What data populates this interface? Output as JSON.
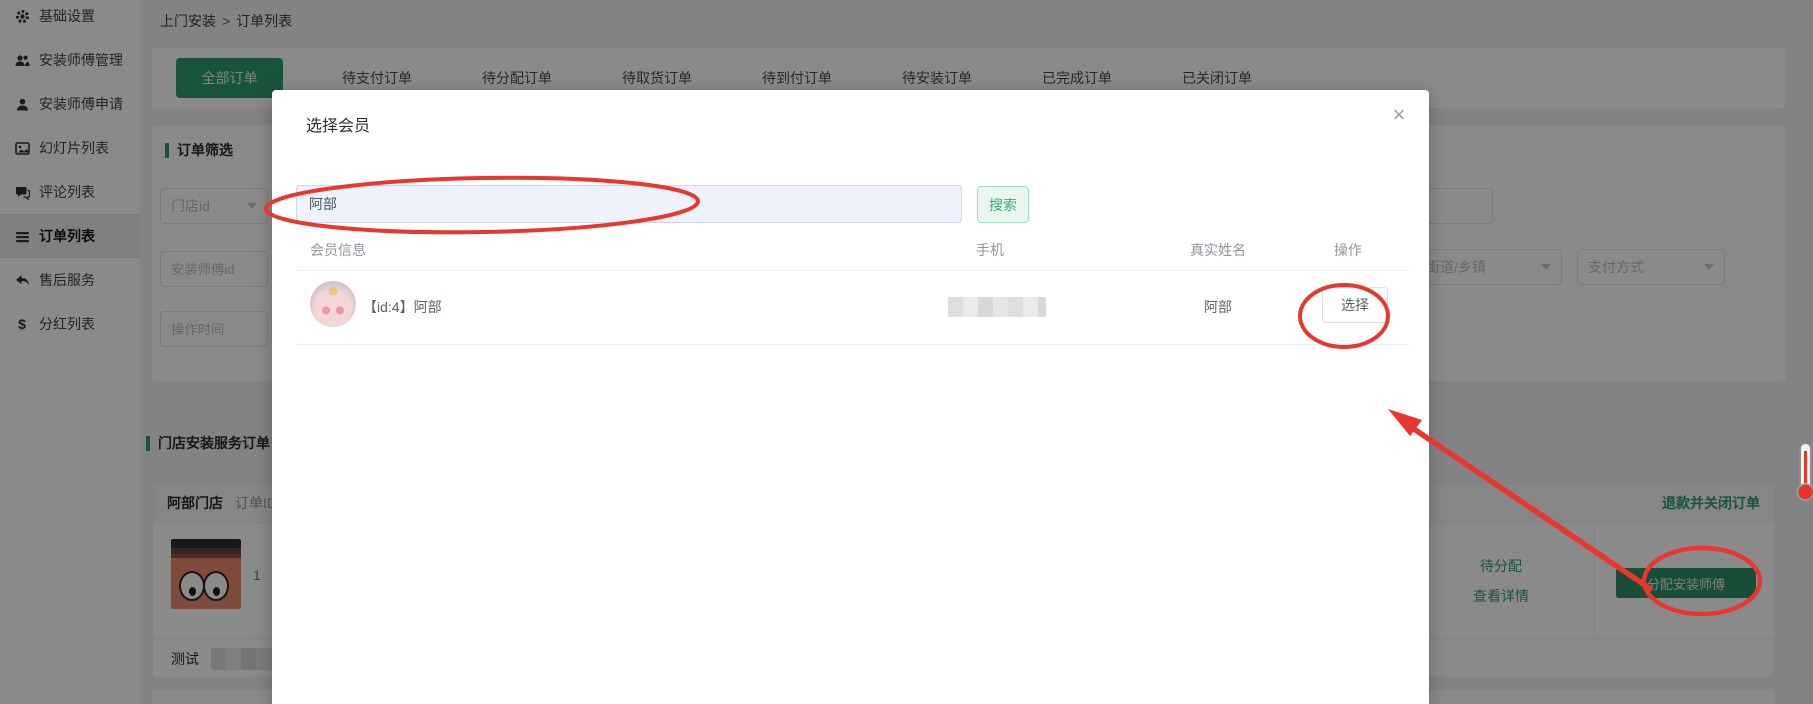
{
  "colors": {
    "accent_green": "#2e9c6f",
    "link_green": "#3aa877",
    "annotation_red": "#e8372c"
  },
  "sidebar": {
    "items": [
      {
        "label": "基础设置",
        "icon": "gear-icon"
      },
      {
        "label": "安装师傅管理",
        "icon": "users-icon"
      },
      {
        "label": "安装师傅申请",
        "icon": "user-icon"
      },
      {
        "label": "幻灯片列表",
        "icon": "slides-icon"
      },
      {
        "label": "评论列表",
        "icon": "comment-icon"
      },
      {
        "label": "订单列表",
        "icon": "list-icon"
      },
      {
        "label": "售后服务",
        "icon": "reply-icon"
      },
      {
        "label": "分红列表",
        "icon": "dollar-icon"
      }
    ],
    "active_index": 5
  },
  "breadcrumb": {
    "section": "上门安装",
    "separator": ">",
    "page": "订单列表"
  },
  "tabs": {
    "items": [
      {
        "label": "全部订单"
      },
      {
        "label": "待支付订单"
      },
      {
        "label": "待分配订单"
      },
      {
        "label": "待取货订单"
      },
      {
        "label": "待到付订单"
      },
      {
        "label": "待安装订单"
      },
      {
        "label": "已完成订单"
      },
      {
        "label": "已关闭订单"
      }
    ],
    "active_index": 0
  },
  "filter": {
    "title": "订单筛选",
    "store_id_select": "门店id",
    "installer_id_placeholder": "安装师傅id",
    "operate_time_placeholder": "操作时间",
    "street_select": "街道/乡镇",
    "payment_select": "支付方式"
  },
  "orders_section": {
    "title": "门店安装服务订单",
    "store_name": "阿部门店",
    "order_id_label": "订单ID:",
    "quantity": "1",
    "refund_close_link": "退款并关闭订单",
    "status": "待分配",
    "view_detail_link": "查看详情",
    "assign_installer_button": "分配安装师傅",
    "footer_label": "测试"
  },
  "modal": {
    "title": "选择会员",
    "close_icon": "×",
    "search_value": "阿部",
    "search_button": "搜索",
    "columns": [
      "会员信息",
      "手机",
      "真实姓名",
      "操作"
    ],
    "member": {
      "name": "【id:4】阿部",
      "real_name": "阿部",
      "select_button": "选择"
    }
  }
}
